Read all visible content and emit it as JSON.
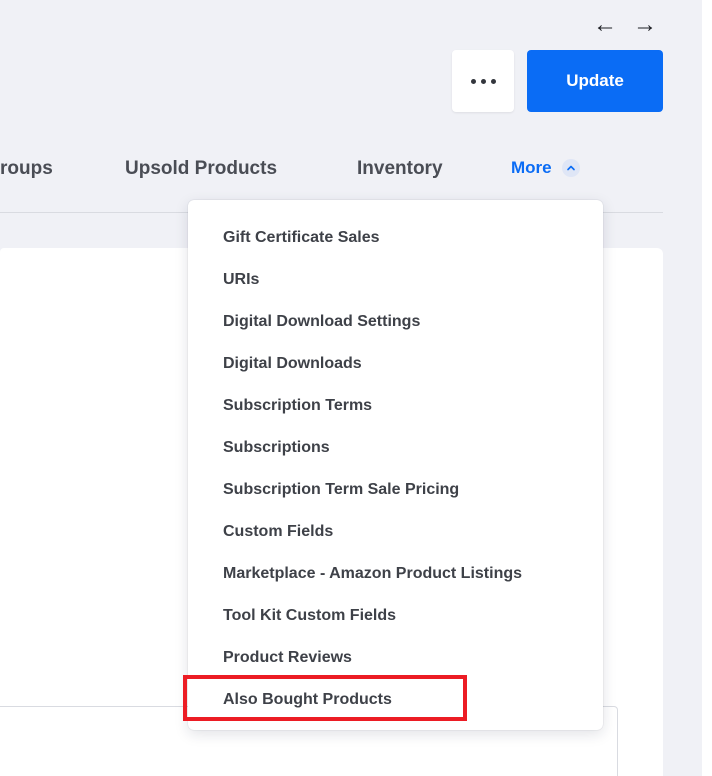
{
  "nav": {
    "back_icon": "←",
    "forward_icon": "→"
  },
  "header": {
    "update_label": "Update"
  },
  "tabs": [
    {
      "label": "roups"
    },
    {
      "label": "Upsold Products"
    },
    {
      "label": "Inventory"
    },
    {
      "label": "More"
    }
  ],
  "dropdown": {
    "items": [
      "Gift Certificate Sales",
      "URIs",
      "Digital Download Settings",
      "Digital Downloads",
      "Subscription Terms",
      "Subscriptions",
      "Subscription Term Sale Pricing",
      "Custom Fields",
      "Marketplace - Amazon Product Listings",
      "Tool Kit Custom Fields",
      "Product Reviews",
      "Also Bought Products"
    ],
    "highlighted_item": "Also Bought Products"
  },
  "colors": {
    "accent": "#0a6cf5",
    "highlight": "#ec1c24",
    "background": "#f0f1f6"
  }
}
